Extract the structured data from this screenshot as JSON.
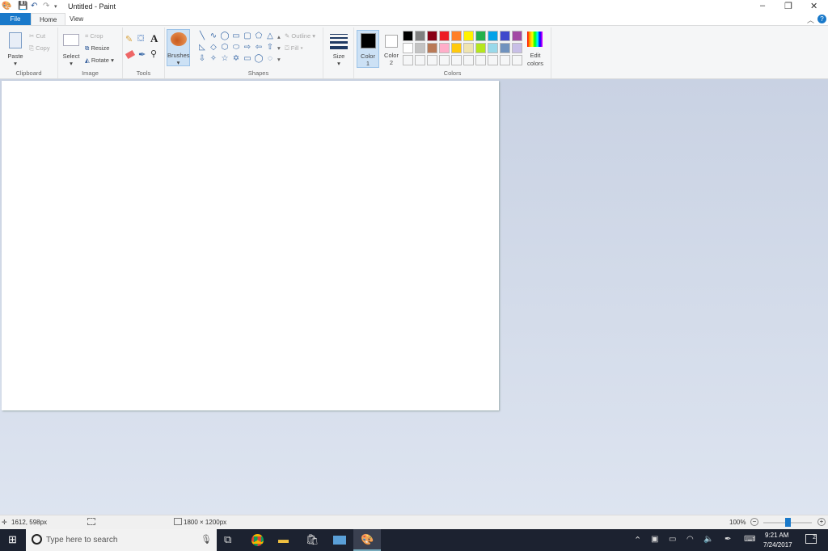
{
  "window": {
    "title": "Untitled - Paint",
    "minimize": "–",
    "restore": "❐",
    "close": "✕"
  },
  "tabs": [
    {
      "label": "File"
    },
    {
      "label": "Home"
    },
    {
      "label": "View"
    }
  ],
  "ribbon": {
    "clipboard": {
      "paste": "Paste",
      "cut": "Cut",
      "copy": "Copy",
      "group": "Clipboard"
    },
    "image": {
      "select": "Select",
      "crop": "Crop",
      "resize": "Resize",
      "rotate": "Rotate",
      "group": "Image"
    },
    "tools": {
      "group": "Tools",
      "text": "A"
    },
    "brushes": {
      "label": "Brushes"
    },
    "shapes": {
      "outline": "Outline",
      "fill": "Fill",
      "group": "Shapes",
      "glyphs": [
        "╲",
        "∿",
        "◯",
        "▭",
        "▢",
        "⬠",
        "△",
        "◺",
        "◇",
        "⬡",
        "⬭",
        "⇨",
        "⇦",
        "⇧",
        "⇩",
        "✧",
        "☆",
        "✡",
        "▭",
        "◯",
        "◌"
      ]
    },
    "size": {
      "label": "Size"
    },
    "color1": {
      "label": "Color",
      "num": "1",
      "color": "#000000"
    },
    "color2": {
      "label": "Color",
      "num": "2",
      "color": "#ffffff"
    },
    "colors": {
      "group": "Colors",
      "edit": "Edit",
      "edit2": "colors",
      "row1": [
        "#000000",
        "#7f7f7f",
        "#880015",
        "#ed1c24",
        "#ff7f27",
        "#fff200",
        "#22b14c",
        "#00a2e8",
        "#3f48cc",
        "#a349a4"
      ],
      "row2": [
        "#ffffff",
        "#c3c3c3",
        "#b97a57",
        "#ffaec9",
        "#ffc90e",
        "#efe4b0",
        "#b5e61d",
        "#99d9ea",
        "#7092be",
        "#c8bfe7"
      ]
    }
  },
  "status": {
    "cursor": "1612, 598px",
    "size": "1800 × 1200px",
    "zoom": "100%"
  },
  "taskbar": {
    "search_placeholder": "Type here to search",
    "time": "9:21 AM",
    "date": "7/24/2017",
    "notifications": "2"
  }
}
